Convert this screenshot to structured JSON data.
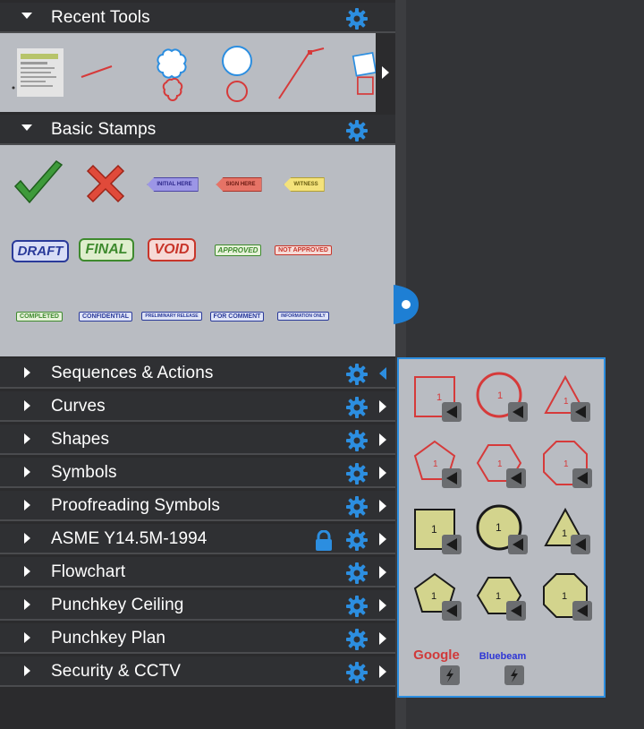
{
  "panel": {
    "sections": [
      {
        "label": "Recent Tools",
        "expanded": true,
        "gear": "gear-icon"
      },
      {
        "label": "Basic Stamps",
        "expanded": true,
        "gear": "gear-icon"
      },
      {
        "label": "Sequences & Actions",
        "expanded": false,
        "flyout_open": true
      },
      {
        "label": "Curves",
        "expanded": false
      },
      {
        "label": "Shapes",
        "expanded": false
      },
      {
        "label": "Symbols",
        "expanded": false
      },
      {
        "label": "Proofreading Symbols",
        "expanded": false
      },
      {
        "label": "ASME Y14.5M-1994",
        "expanded": false,
        "locked": true
      },
      {
        "label": "Flowchart",
        "expanded": false
      },
      {
        "label": "Punchkey Ceiling",
        "expanded": false
      },
      {
        "label": "Punchkey Plan",
        "expanded": false
      },
      {
        "label": "Security & CCTV",
        "expanded": false
      }
    ]
  },
  "recent_tools": [
    "document-thumbnail",
    "line-tool",
    "cloud-sequence",
    "circle-sequence",
    "polyline-tool",
    "square-sequence"
  ],
  "stamps": {
    "row1": [
      "checkmark-stamp",
      "x-stamp",
      "INITIAL HERE",
      "SIGN HERE",
      "WITNESS"
    ],
    "row2": [
      "DRAFT",
      "FINAL",
      "VOID",
      "APPROVED",
      "NOT APPROVED"
    ],
    "row3": [
      "COMPLETED",
      "CONFIDENTIAL",
      "PRELIMINARY RELEASE",
      "FOR COMMENT",
      "INFORMATION ONLY"
    ]
  },
  "flyout": {
    "item_number": "1",
    "text_items": [
      "Google",
      "Bluebeam"
    ]
  },
  "colors": {
    "accent": "#2c8ee0",
    "red_shape": "#d63a3a",
    "olive_fill": "#d3d48d"
  }
}
